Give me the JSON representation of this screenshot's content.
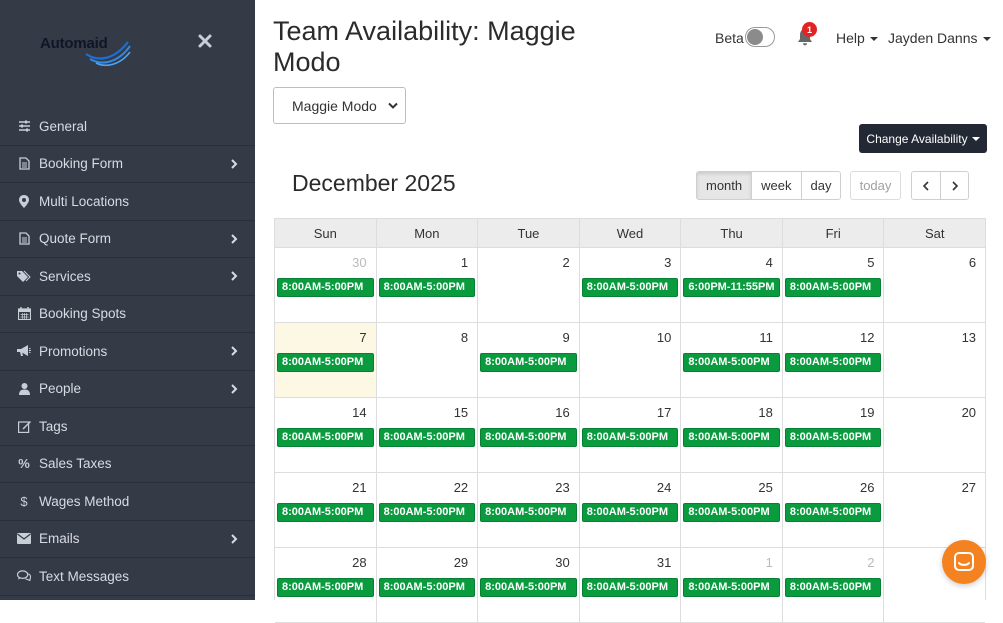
{
  "brand": {
    "logo_text": "Automaid"
  },
  "sidebar": {
    "items": [
      {
        "label": "General",
        "icon": "sliders-icon",
        "has_children": false
      },
      {
        "label": "Booking Form",
        "icon": "file-icon",
        "has_children": true
      },
      {
        "label": "Multi Locations",
        "icon": "map-marker-icon",
        "has_children": false
      },
      {
        "label": "Quote Form",
        "icon": "file-icon",
        "has_children": true
      },
      {
        "label": "Services",
        "icon": "tags-icon",
        "has_children": true
      },
      {
        "label": "Booking Spots",
        "icon": "calendar-icon",
        "has_children": false
      },
      {
        "label": "Promotions",
        "icon": "bullhorn-icon",
        "has_children": true
      },
      {
        "label": "People",
        "icon": "user-icon",
        "has_children": true
      },
      {
        "label": "Tags",
        "icon": "edit-icon",
        "has_children": false
      },
      {
        "label": "Sales Taxes",
        "icon": "percent-icon",
        "has_children": false
      },
      {
        "label": "Wages Method",
        "icon": "dollar-icon",
        "has_children": false
      },
      {
        "label": "Emails",
        "icon": "envelope-icon",
        "has_children": true
      },
      {
        "label": "Text Messages",
        "icon": "comments-icon",
        "has_children": false
      }
    ]
  },
  "header": {
    "title": "Team Availability: Maggie Modo",
    "beta_label": "Beta",
    "notification_count": "1",
    "help_label": "Help",
    "user_name": "Jayden Danns",
    "selected_person": "Maggie Modo",
    "change_availability_label": "Change Availability"
  },
  "calendar": {
    "title": "December 2025",
    "views": {
      "month": "month",
      "week": "week",
      "day": "day"
    },
    "active_view": "month",
    "today_label": "today",
    "days_of_week": [
      "Sun",
      "Mon",
      "Tue",
      "Wed",
      "Thu",
      "Fri",
      "Sat"
    ],
    "weeks": [
      [
        {
          "num": "30",
          "other": true,
          "event": "8:00AM-5:00PM"
        },
        {
          "num": "1",
          "event": "8:00AM-5:00PM"
        },
        {
          "num": "2",
          "event": ""
        },
        {
          "num": "3",
          "event": "8:00AM-5:00PM"
        },
        {
          "num": "4",
          "event": "6:00PM-11:55PM"
        },
        {
          "num": "5",
          "event": "8:00AM-5:00PM"
        },
        {
          "num": "6",
          "event": ""
        }
      ],
      [
        {
          "num": "7",
          "today": true,
          "event": "8:00AM-5:00PM"
        },
        {
          "num": "8",
          "event": ""
        },
        {
          "num": "9",
          "event": "8:00AM-5:00PM"
        },
        {
          "num": "10",
          "event": ""
        },
        {
          "num": "11",
          "event": "8:00AM-5:00PM"
        },
        {
          "num": "12",
          "event": "8:00AM-5:00PM"
        },
        {
          "num": "13",
          "event": ""
        }
      ],
      [
        {
          "num": "14",
          "event": "8:00AM-5:00PM"
        },
        {
          "num": "15",
          "event": "8:00AM-5:00PM"
        },
        {
          "num": "16",
          "event": "8:00AM-5:00PM"
        },
        {
          "num": "17",
          "event": "8:00AM-5:00PM"
        },
        {
          "num": "18",
          "event": "8:00AM-5:00PM"
        },
        {
          "num": "19",
          "event": "8:00AM-5:00PM"
        },
        {
          "num": "20",
          "event": ""
        }
      ],
      [
        {
          "num": "21",
          "event": "8:00AM-5:00PM"
        },
        {
          "num": "22",
          "event": "8:00AM-5:00PM"
        },
        {
          "num": "23",
          "event": "8:00AM-5:00PM"
        },
        {
          "num": "24",
          "event": "8:00AM-5:00PM"
        },
        {
          "num": "25",
          "event": "8:00AM-5:00PM"
        },
        {
          "num": "26",
          "event": "8:00AM-5:00PM"
        },
        {
          "num": "27",
          "event": ""
        }
      ],
      [
        {
          "num": "28",
          "event": "8:00AM-5:00PM"
        },
        {
          "num": "29",
          "event": "8:00AM-5:00PM"
        },
        {
          "num": "30",
          "event": "8:00AM-5:00PM"
        },
        {
          "num": "31",
          "event": "8:00AM-5:00PM"
        },
        {
          "num": "1",
          "other": true,
          "event": "8:00AM-5:00PM"
        },
        {
          "num": "2",
          "other": true,
          "event": "8:00AM-5:00PM"
        },
        {
          "num": "",
          "event": ""
        }
      ]
    ]
  },
  "colors": {
    "sidebar_bg": "#353a47",
    "event_green": "#0a9b3f",
    "today_highlight": "#fcf8e3",
    "chat_orange": "#f58220",
    "badge_red": "#e02424"
  }
}
